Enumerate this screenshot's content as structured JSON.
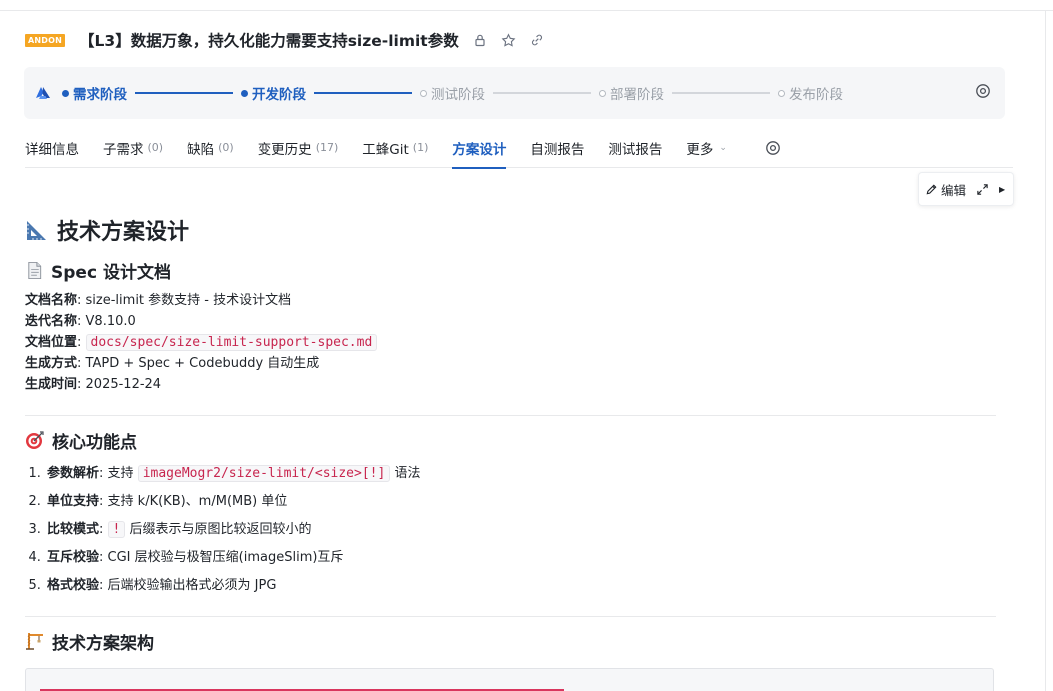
{
  "header": {
    "badge": "ANDON",
    "title": "【L3】数据万象，持久化能力需要支持size-limit参数"
  },
  "stages": [
    {
      "label": "需求阶段",
      "state": "active"
    },
    {
      "label": "开发阶段",
      "state": "active"
    },
    {
      "label": "测试阶段",
      "state": "inactive"
    },
    {
      "label": "部署阶段",
      "state": "inactive"
    },
    {
      "label": "发布阶段",
      "state": "inactive"
    }
  ],
  "tabs": [
    {
      "label": "详细信息",
      "count": ""
    },
    {
      "label": "子需求",
      "count": "(0)"
    },
    {
      "label": "缺陷",
      "count": "(0)"
    },
    {
      "label": "变更历史",
      "count": "(17)"
    },
    {
      "label": "工蜂Git",
      "count": "(1)"
    },
    {
      "label": "方案设计",
      "count": "",
      "active": true
    },
    {
      "label": "自测报告",
      "count": ""
    },
    {
      "label": "测试报告",
      "count": ""
    },
    {
      "label": "更多",
      "count": ""
    }
  ],
  "toolbar": {
    "edit_label": "编辑"
  },
  "doc": {
    "h1": "技术方案设计",
    "spec_heading": "Spec 设计文档",
    "meta": {
      "name_key": "文档名称",
      "name_val": "size-limit 参数支持 - 技术设计文档",
      "iter_key": "迭代名称",
      "iter_val": "V8.10.0",
      "loc_key": "文档位置",
      "loc_val": "docs/spec/size-limit-support-spec.md",
      "gen_key": "生成方式",
      "gen_val": "TAPD + Spec + Codebuddy 自动生成",
      "time_key": "生成时间",
      "time_val": "2025-12-24"
    },
    "core_heading": "核心功能点",
    "features": {
      "f1_key": "参数解析",
      "f1_pre": "支持",
      "f1_code": "imageMogr2/size-limit/<size>[!]",
      "f1_post": "语法",
      "f2_key": "单位支持",
      "f2_val": "支持 k/K(KB)、m/M(MB) 单位",
      "f3_key": "比较模式",
      "f3_code": "!",
      "f3_post": "后缀表示与原图比较返回较小的",
      "f4_key": "互斥校验",
      "f4_val": "CGI 层校验与极智压缩(imageSlim)互斥",
      "f5_key": "格式校验",
      "f5_val": "后端校验输出格式必须为 JPG"
    },
    "arch_heading": "技术方案架构"
  },
  "colors": {
    "accent": "#1f5fbf",
    "badge": "#f5a623",
    "code_text": "#c7254e"
  }
}
